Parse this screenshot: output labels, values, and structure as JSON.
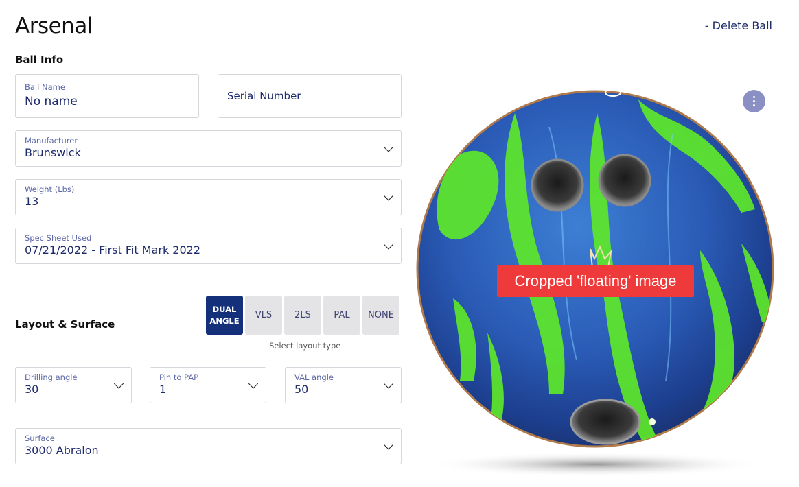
{
  "header": {
    "title": "Arsenal",
    "delete_label": "- Delete Ball"
  },
  "ball_info": {
    "section_title": "Ball Info",
    "ball_name": {
      "label": "Ball Name",
      "value": "No name"
    },
    "serial_number": {
      "placeholder": "Serial Number"
    },
    "manufacturer": {
      "label": "Manufacturer",
      "value": "Brunswick"
    },
    "weight": {
      "label": "Weight (Lbs)",
      "value": "13"
    },
    "spec_sheet": {
      "label": "Spec Sheet Used",
      "value": "07/21/2022 - First Fit Mark 2022"
    }
  },
  "layout_surface": {
    "section_title": "Layout & Surface",
    "layout_types": [
      "DUAL\nANGLE",
      "VLS",
      "2LS",
      "PAL",
      "NONE"
    ],
    "selected_layout": "DUAL ANGLE",
    "layout_hint": "Select layout type",
    "drilling_angle": {
      "label": "Drilling angle",
      "value": "30"
    },
    "pin_to_pap": {
      "label": "Pin to PAP",
      "value": "1"
    },
    "val_angle": {
      "label": "VAL angle",
      "value": "50"
    },
    "surface": {
      "label": "Surface",
      "value": "3000 Abralon"
    }
  },
  "image": {
    "overlay_text": "Cropped 'floating' image",
    "menu_icon": "more-vertical-icon"
  },
  "colors": {
    "primary": "#14307a",
    "text": "#1d2a6b",
    "label": "#5a66a6",
    "segment_bg": "#e4e4e6",
    "menu_button": "#8a8fc4",
    "overlay": "#ee3a3a"
  }
}
